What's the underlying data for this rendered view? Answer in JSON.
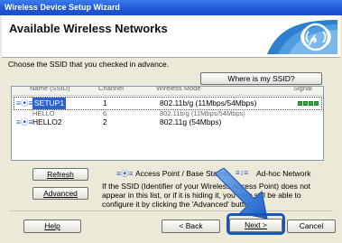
{
  "window": {
    "title": "Wireless Device Setup Wizard",
    "heading": "Available Wireless Networks",
    "instruction": "Choose the SSID that you checked in advance."
  },
  "buttons": {
    "where_ssid": "Where is my SSID?",
    "refresh": "Refresh",
    "advanced": "Advanced",
    "help": "Help",
    "back": "< Back",
    "next": "Next >",
    "cancel": "Cancel"
  },
  "networks": [
    {
      "ssid": "SETUP1",
      "channel": "1",
      "mode": "802.11b/g (11Mbps/54Mbps)",
      "signal": 4,
      "selected": true
    },
    {
      "ssid": "HELLO2",
      "channel": "2",
      "mode": "802.11g (54Mbps)",
      "signal": 3,
      "selected": false
    }
  ],
  "ghost_row": {
    "ssid": "HELLO",
    "channel": "6",
    "mode": "802.11b/g (11Mbps/54Mbps)"
  },
  "legend": {
    "ap_label": "Access Point / Base Station",
    "adhoc_label": "Ad-hoc Network"
  },
  "info_text": "If the SSID (Identifier of your Wireless Access Point) does not appear in this list, or if it is hiding it, you may still be able to configure it by clicking the 'Advanced' button.",
  "colors": {
    "accent": "#1657b8",
    "signal": "#35a843",
    "selection": "#2d62cf"
  }
}
